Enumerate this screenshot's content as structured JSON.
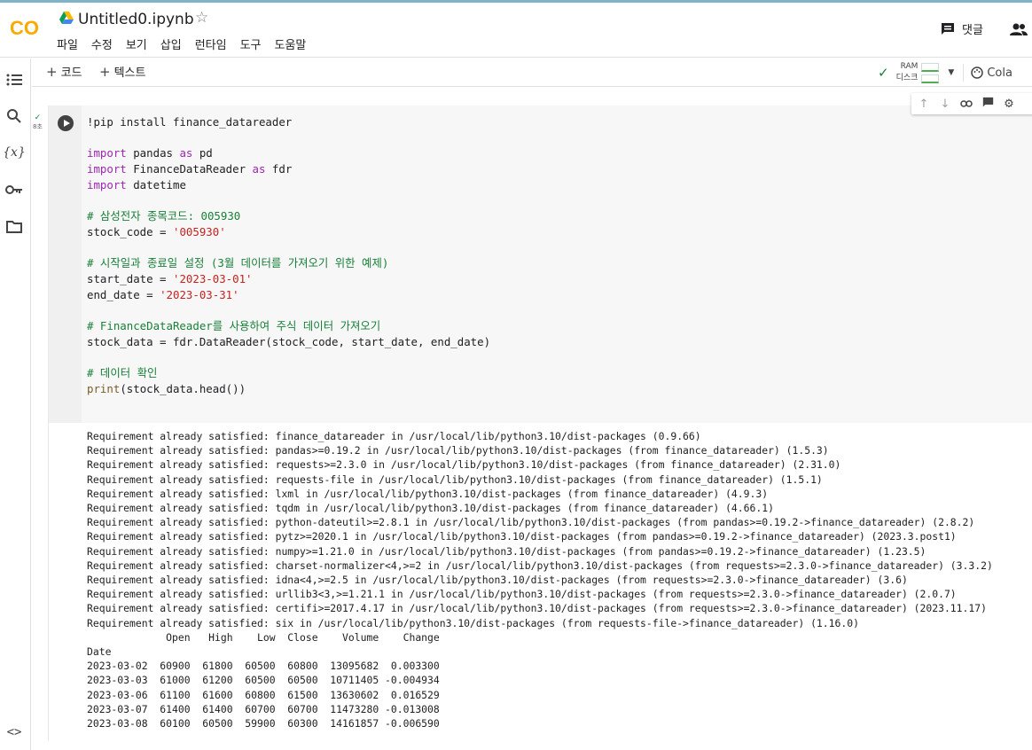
{
  "header": {
    "logo_text": "CO",
    "title": "Untitled0.ipynb",
    "menu": [
      "파일",
      "수정",
      "보기",
      "삽입",
      "런타임",
      "도구",
      "도움말"
    ],
    "comment_label": "댓글"
  },
  "toolbar": {
    "add_code": "코드",
    "add_text": "텍스트",
    "ram_label": "RAM",
    "disk_label": "디스크",
    "colab_label": "Cola"
  },
  "cell": {
    "run_time": "8초",
    "code_lines": [
      [
        {
          "t": "!pip install finance_datareader",
          "c": ""
        }
      ],
      [],
      [
        {
          "t": "import",
          "c": "kw"
        },
        {
          "t": " pandas ",
          "c": ""
        },
        {
          "t": "as",
          "c": "kw"
        },
        {
          "t": " pd",
          "c": ""
        }
      ],
      [
        {
          "t": "import",
          "c": "kw"
        },
        {
          "t": " FinanceDataReader ",
          "c": ""
        },
        {
          "t": "as",
          "c": "kw"
        },
        {
          "t": " fdr",
          "c": ""
        }
      ],
      [
        {
          "t": "import",
          "c": "kw"
        },
        {
          "t": " datetime",
          "c": ""
        }
      ],
      [],
      [
        {
          "t": "# 삼성전자 종목코드: 005930",
          "c": "cm"
        }
      ],
      [
        {
          "t": "stock_code = ",
          "c": ""
        },
        {
          "t": "'005930'",
          "c": "st"
        }
      ],
      [],
      [
        {
          "t": "# 시작일과 종료일 설정 (3월 데이터를 가져오기 위한 예제)",
          "c": "cm"
        }
      ],
      [
        {
          "t": "start_date = ",
          "c": ""
        },
        {
          "t": "'2023-03-01'",
          "c": "st"
        }
      ],
      [
        {
          "t": "end_date = ",
          "c": ""
        },
        {
          "t": "'2023-03-31'",
          "c": "st"
        }
      ],
      [],
      [
        {
          "t": "# FinanceDataReader를 사용하여 주식 데이터 가져오기",
          "c": "cm"
        }
      ],
      [
        {
          "t": "stock_data = fdr.DataReader(stock_code, start_date, end_date)",
          "c": ""
        }
      ],
      [],
      [
        {
          "t": "# 데이터 확인",
          "c": "cm"
        }
      ],
      [
        {
          "t": "print",
          "c": "fn"
        },
        {
          "t": "(stock_data.head())",
          "c": ""
        }
      ]
    ],
    "output_lines": [
      "Requirement already satisfied: finance_datareader in /usr/local/lib/python3.10/dist-packages (0.9.66)",
      "Requirement already satisfied: pandas>=0.19.2 in /usr/local/lib/python3.10/dist-packages (from finance_datareader) (1.5.3)",
      "Requirement already satisfied: requests>=2.3.0 in /usr/local/lib/python3.10/dist-packages (from finance_datareader) (2.31.0)",
      "Requirement already satisfied: requests-file in /usr/local/lib/python3.10/dist-packages (from finance_datareader) (1.5.1)",
      "Requirement already satisfied: lxml in /usr/local/lib/python3.10/dist-packages (from finance_datareader) (4.9.3)",
      "Requirement already satisfied: tqdm in /usr/local/lib/python3.10/dist-packages (from finance_datareader) (4.66.1)",
      "Requirement already satisfied: python-dateutil>=2.8.1 in /usr/local/lib/python3.10/dist-packages (from pandas>=0.19.2->finance_datareader) (2.8.2)",
      "Requirement already satisfied: pytz>=2020.1 in /usr/local/lib/python3.10/dist-packages (from pandas>=0.19.2->finance_datareader) (2023.3.post1)",
      "Requirement already satisfied: numpy>=1.21.0 in /usr/local/lib/python3.10/dist-packages (from pandas>=0.19.2->finance_datareader) (1.23.5)",
      "Requirement already satisfied: charset-normalizer<4,>=2 in /usr/local/lib/python3.10/dist-packages (from requests>=2.3.0->finance_datareader) (3.3.2)",
      "Requirement already satisfied: idna<4,>=2.5 in /usr/local/lib/python3.10/dist-packages (from requests>=2.3.0->finance_datareader) (3.6)",
      "Requirement already satisfied: urllib3<3,>=1.21.1 in /usr/local/lib/python3.10/dist-packages (from requests>=2.3.0->finance_datareader) (2.0.7)",
      "Requirement already satisfied: certifi>=2017.4.17 in /usr/local/lib/python3.10/dist-packages (from requests>=2.3.0->finance_datareader) (2023.11.17)",
      "Requirement already satisfied: six in /usr/local/lib/python3.10/dist-packages (from requests-file->finance_datareader) (1.16.0)",
      "             Open   High    Low  Close    Volume    Change",
      "Date",
      "2023-03-02  60900  61800  60500  60800  13095682  0.003300",
      "2023-03-03  61000  61200  60500  60500  10711405 -0.004934",
      "2023-03-06  61100  61600  60800  61500  13630602  0.016529",
      "2023-03-07  61400  61400  60700  60700  11473280 -0.013008",
      "2023-03-08  60100  60500  59900  60300  14161857 -0.006590"
    ]
  },
  "colors": {
    "keyword": "#9c27b0",
    "comment": "#188038",
    "string": "#c5221f",
    "logo_orange": "#f9ab00",
    "logo_red": "#e8710a"
  }
}
